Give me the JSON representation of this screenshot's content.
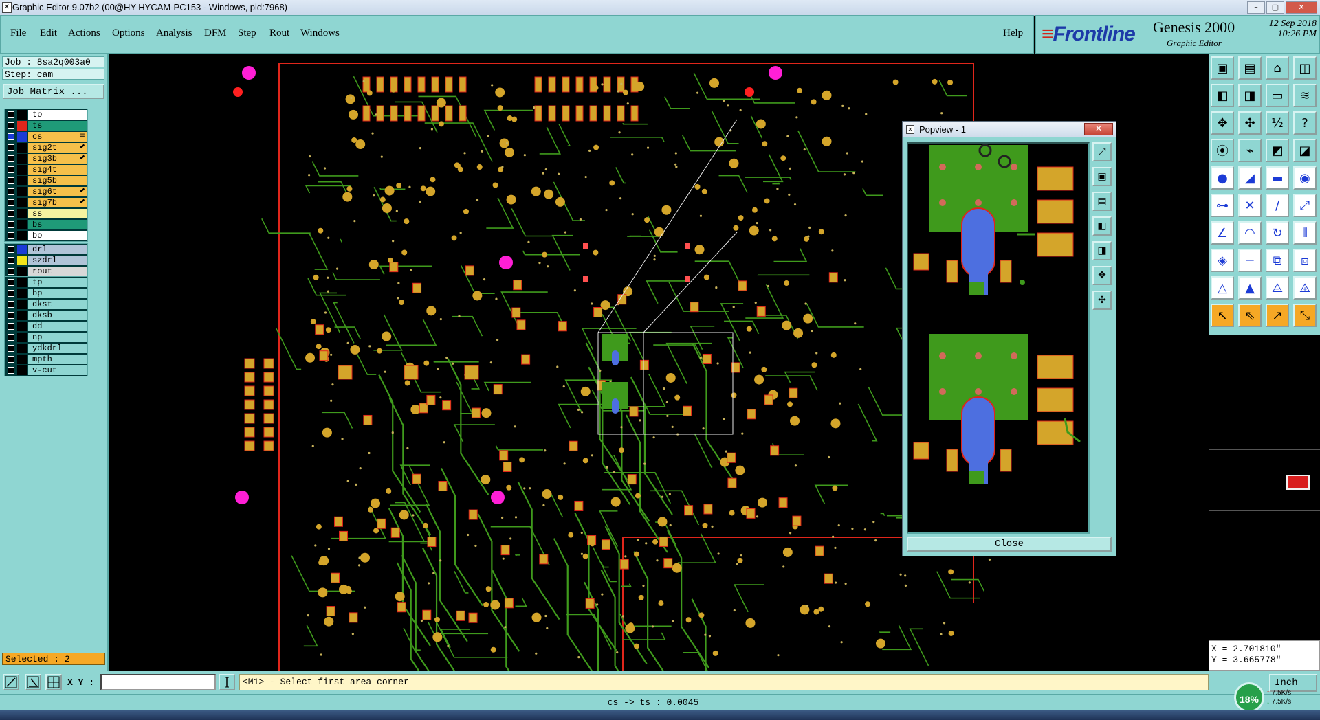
{
  "window": {
    "title": "Graphic Editor 9.07b2 (00@HY-HYCAM-PC153 - Windows, pid:7968)",
    "controls": [
      "–",
      "▢",
      "✕"
    ]
  },
  "menu": {
    "items": [
      {
        "label": "File",
        "key": "F"
      },
      {
        "label": "Edit",
        "key": "E"
      },
      {
        "label": "Actions",
        "key": "A"
      },
      {
        "label": "Options",
        "key": "O"
      },
      {
        "label": "Analysis",
        "key": "A"
      },
      {
        "label": "DFM",
        "key": "D"
      },
      {
        "label": "Step",
        "key": "S"
      },
      {
        "label": "Rout",
        "key": "R"
      },
      {
        "label": "Windows",
        "key": "W"
      }
    ],
    "help": "Help"
  },
  "brand": {
    "logo": "Frontline",
    "product": "Genesis 2000",
    "subtitle": "Graphic Editor",
    "date": "12 Sep 2018",
    "time": "10:26 PM"
  },
  "left": {
    "job": "Job : 8sa2q003a0",
    "step": "Step: cam",
    "job_matrix": "Job Matrix ...",
    "groups": [
      {
        "layers": [
          {
            "name": "to",
            "swatch": "#000000",
            "bg": "#ffffff",
            "mark": ""
          },
          {
            "name": "ts",
            "swatch": "#e0261b",
            "bg": "#1f9a78",
            "mark": ""
          },
          {
            "name": "cs",
            "swatch": "#1c3bd6",
            "bg": "#f6c04a",
            "mark": "≡",
            "active": true
          },
          {
            "name": "sig2t",
            "swatch": "#000000",
            "bg": "#f6c04a",
            "mark": "⬋"
          },
          {
            "name": "sig3b",
            "swatch": "#000000",
            "bg": "#f6c04a",
            "mark": "⬋"
          },
          {
            "name": "sig4t",
            "swatch": "#000000",
            "bg": "#f6c04a",
            "mark": ""
          },
          {
            "name": "sig5b",
            "swatch": "#000000",
            "bg": "#f6c04a",
            "mark": ""
          },
          {
            "name": "sig6t",
            "swatch": "#000000",
            "bg": "#f6c04a",
            "mark": "⬋"
          },
          {
            "name": "sig7b",
            "swatch": "#000000",
            "bg": "#f6c04a",
            "mark": "⬋"
          },
          {
            "name": "ss",
            "swatch": "#000000",
            "bg": "#f6f3a0",
            "mark": ""
          },
          {
            "name": "bs",
            "swatch": "#000000",
            "bg": "#1f9a78",
            "mark": ""
          },
          {
            "name": "bo",
            "swatch": "#000000",
            "bg": "#ffffff",
            "mark": ""
          }
        ]
      },
      {
        "layers": [
          {
            "name": "drl",
            "swatch": "#1c3bd6",
            "bg": "#b0c4d8",
            "mark": ""
          },
          {
            "name": "szdrl",
            "swatch": "#f2e41a",
            "bg": "#b0c4d8",
            "mark": ""
          },
          {
            "name": "rout",
            "swatch": "#000000",
            "bg": "#d8d8d8",
            "mark": ""
          }
        ]
      },
      {
        "layers": [
          {
            "name": "tp",
            "swatch": "#000000",
            "bg": "#8fd6d2",
            "mark": ""
          },
          {
            "name": "bp",
            "swatch": "#000000",
            "bg": "#8fd6d2",
            "mark": ""
          },
          {
            "name": "dkst",
            "swatch": "#000000",
            "bg": "#8fd6d2",
            "mark": ""
          },
          {
            "name": "dksb",
            "swatch": "#000000",
            "bg": "#8fd6d2",
            "mark": ""
          },
          {
            "name": "dd",
            "swatch": "#000000",
            "bg": "#8fd6d2",
            "mark": ""
          },
          {
            "name": "np",
            "swatch": "#000000",
            "bg": "#8fd6d2",
            "mark": ""
          },
          {
            "name": "ydkdrl",
            "swatch": "#000000",
            "bg": "#8fd6d2",
            "mark": ""
          },
          {
            "name": "mpth",
            "swatch": "#000000",
            "bg": "#8fd6d2",
            "mark": ""
          },
          {
            "name": "v-cut",
            "swatch": "#000000",
            "bg": "#8fd6d2",
            "mark": ""
          }
        ]
      }
    ],
    "selected": "Selected : 2"
  },
  "popview": {
    "title": "Popview - 1",
    "close_x": "✕",
    "close_button": "Close",
    "tools": [
      "zoom-fit-icon",
      "zoom-home-icon",
      "zoom-in-icon",
      "zoom-out-icon",
      "pan-icon",
      "expand-icon",
      "shrink-icon"
    ]
  },
  "tools": [
    "zoom-home-icon",
    "zoom-step-icon",
    "home-icon",
    "split-view-icon",
    "pan-left-icon",
    "pan-right-icon",
    "zoom-area-icon",
    "flip-icon",
    "fit-icon",
    "center-icon",
    "scale-icon",
    "help-icon",
    "measure-icon",
    "snap-icon",
    "layer-compare-icon",
    "layer-swap-icon",
    "pad-add-icon",
    "surface-add-icon",
    "ruler-icon",
    "via-icon",
    "connect-icon",
    "disconnect-icon",
    "node-icon",
    "line-node-icon",
    "line-draw-icon",
    "arc-draw-icon",
    "rotate-icon",
    "mirror-icon",
    "feature-edit-icon",
    "trace-icon",
    "align-icon",
    "copy-icon",
    "triangle-a-icon",
    "triangle-b-icon",
    "triangle-c-icon",
    "triangle-d-icon",
    "select-icon",
    "select-move-icon",
    "select-edit-icon",
    "select-net-icon"
  ],
  "coords": {
    "x": "X = 2.701810\"",
    "y": "Y = 3.665778\""
  },
  "bottom": {
    "xy_label": "X Y :",
    "xy_value": "",
    "prompt": "<M1> - Select first area corner",
    "units": "Inch",
    "status": "cs -> ts : 0.0045"
  },
  "net": {
    "percent": "18%",
    "up": "7.5K/s",
    "down": "7.5K/s"
  },
  "colors": {
    "panel": "#8fd6d2",
    "copper": "#d4a52a",
    "trace": "#3f9a1c",
    "outline": "#e0261b",
    "fiducial": "#ff1fd6",
    "drill": "#4d6fe0"
  }
}
